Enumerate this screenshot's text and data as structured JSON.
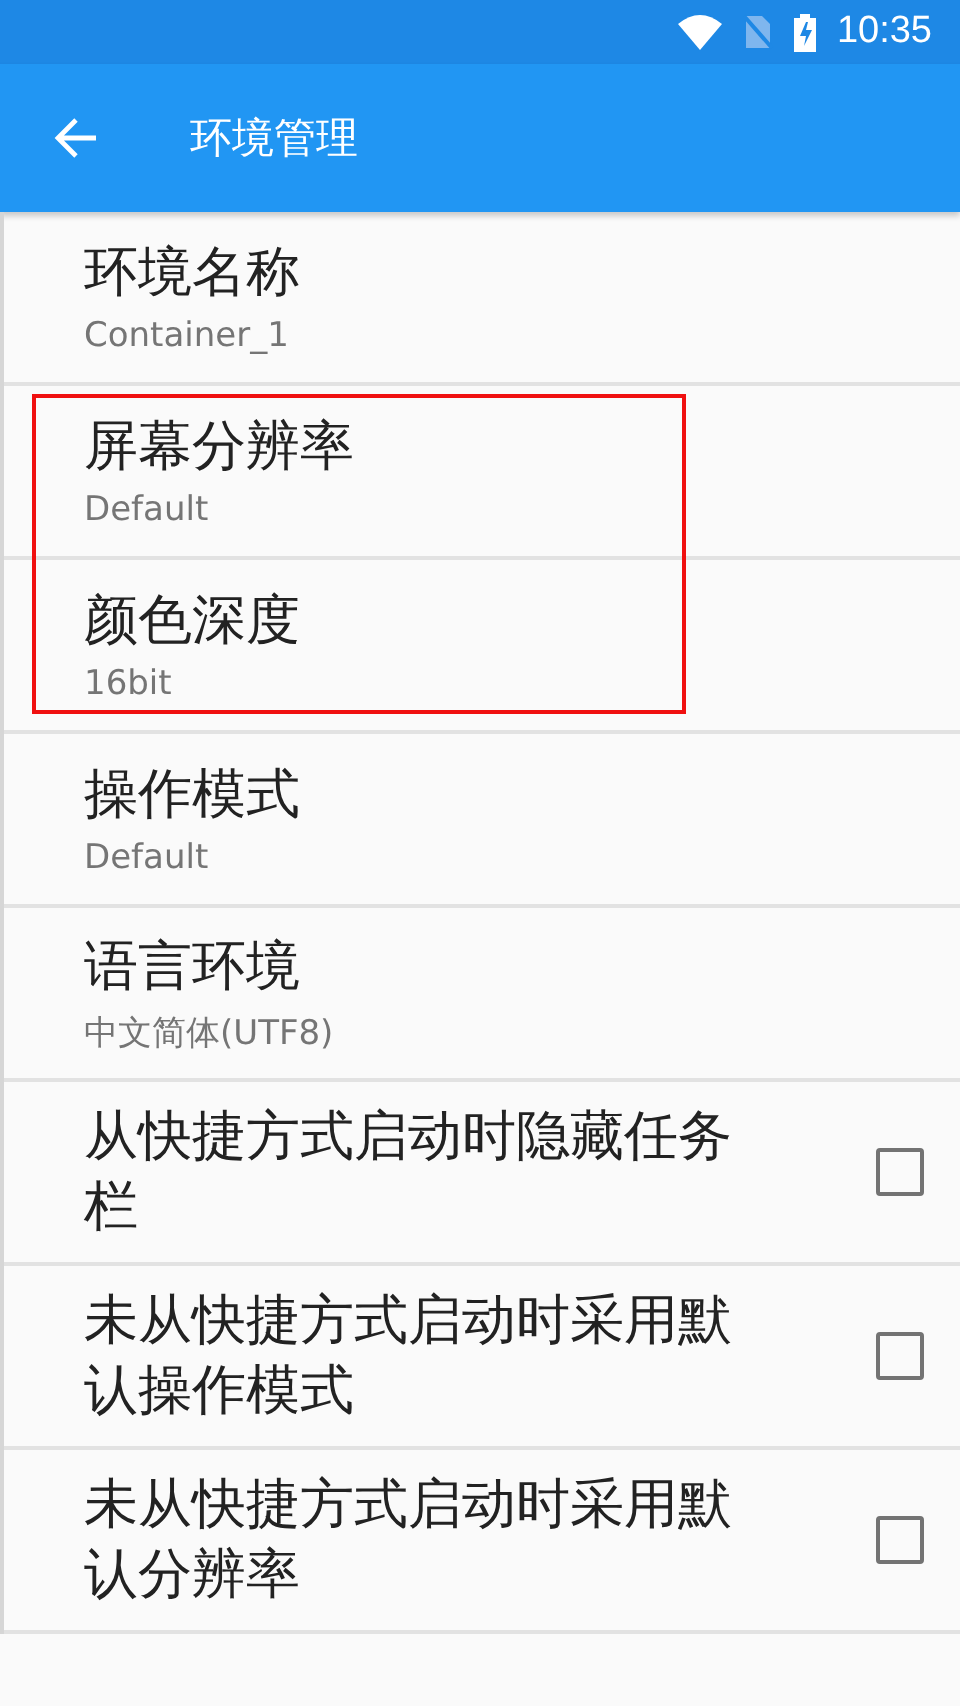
{
  "status_bar": {
    "time": "10:35"
  },
  "toolbar": {
    "title": "环境管理"
  },
  "preferences": [
    {
      "kind": "text",
      "title": "环境名称",
      "summary": "Container_1",
      "highlighted": false
    },
    {
      "kind": "text",
      "title": "屏幕分辨率",
      "summary": "Default",
      "highlighted": true
    },
    {
      "kind": "text",
      "title": "颜色深度",
      "summary": "16bit",
      "highlighted": true
    },
    {
      "kind": "text",
      "title": "操作模式",
      "summary": "Default",
      "highlighted": false
    },
    {
      "kind": "text",
      "title": "语言环境",
      "summary": "中文简体(UTF8)",
      "highlighted": false
    },
    {
      "kind": "checkbox",
      "title": "从快捷方式启动时隐藏任务栏",
      "checked": false,
      "highlighted": false
    },
    {
      "kind": "checkbox",
      "title": "未从快捷方式启动时采用默认操作模式",
      "checked": false,
      "highlighted": false
    },
    {
      "kind": "checkbox",
      "title": "未从快捷方式启动时采用默认分辨率",
      "checked": false,
      "highlighted": false
    }
  ]
}
